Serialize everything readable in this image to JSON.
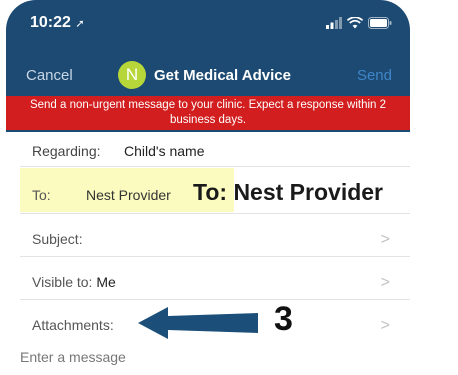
{
  "status_bar": {
    "time": "10:22",
    "icons": [
      "location-arrow-icon",
      "signal-icon",
      "wifi-icon",
      "battery-icon"
    ]
  },
  "nav": {
    "cancel_label": "Cancel",
    "avatar_letter": "N",
    "title": "Get Medical Advice",
    "send_label": "Send"
  },
  "banner": {
    "text": "Send a non-urgent message to your clinic. Expect a response within 2 business days."
  },
  "form": {
    "regarding_label": "Regarding:",
    "regarding_value": "Child's name",
    "to_label": "To:",
    "to_value": "Nest Provider",
    "subject_label": "Subject:",
    "visible_label": "Visible to:",
    "visible_value": "Me",
    "attachments_label": "Attachments:",
    "message_placeholder": "Enter a message"
  },
  "annotations": {
    "to_callout": "To: Nest Provider",
    "step_number": "3"
  },
  "colors": {
    "header_bg": "#1c4a72",
    "banner_bg": "#d21e1e",
    "avatar_bg": "#b6d63a",
    "highlight": "#fbfbbf",
    "arrow": "#1b4f7a",
    "send_link": "#3f86c9"
  }
}
